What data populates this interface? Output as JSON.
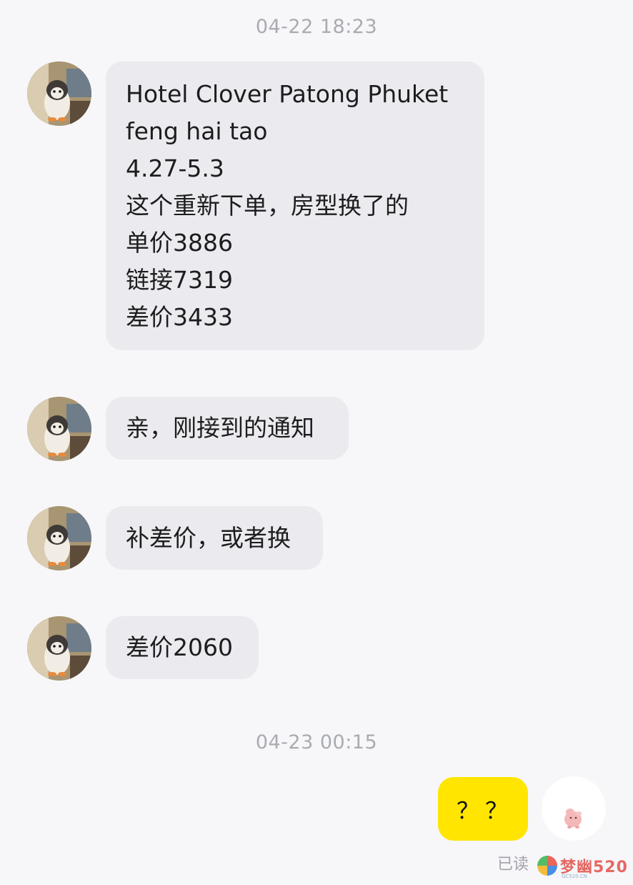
{
  "timestamps": [
    "04-22 18:23",
    "04-23 00:15"
  ],
  "messages": {
    "m1_lines": [
      "Hotel Clover Patong Phuket",
      "feng hai tao",
      "4.27-5.3",
      "这个重新下单，房型换了的",
      "单价3886",
      "链接7319",
      "差价3433"
    ],
    "m2": "亲，刚接到的通知",
    "m3": "补差价，或者换",
    "m4": "差价2060",
    "mine": "？？"
  },
  "status": {
    "read": "已读"
  },
  "watermark": {
    "text": "梦幽520",
    "sub": "GC520.CN"
  },
  "colors": {
    "my_bubble": "#ffe500",
    "their_bubble": "#ebebef",
    "background": "#f7f7f9"
  },
  "icons": {
    "their_avatar": "penguin-plush-avatar",
    "my_avatar": "pink-pig-avatar"
  }
}
